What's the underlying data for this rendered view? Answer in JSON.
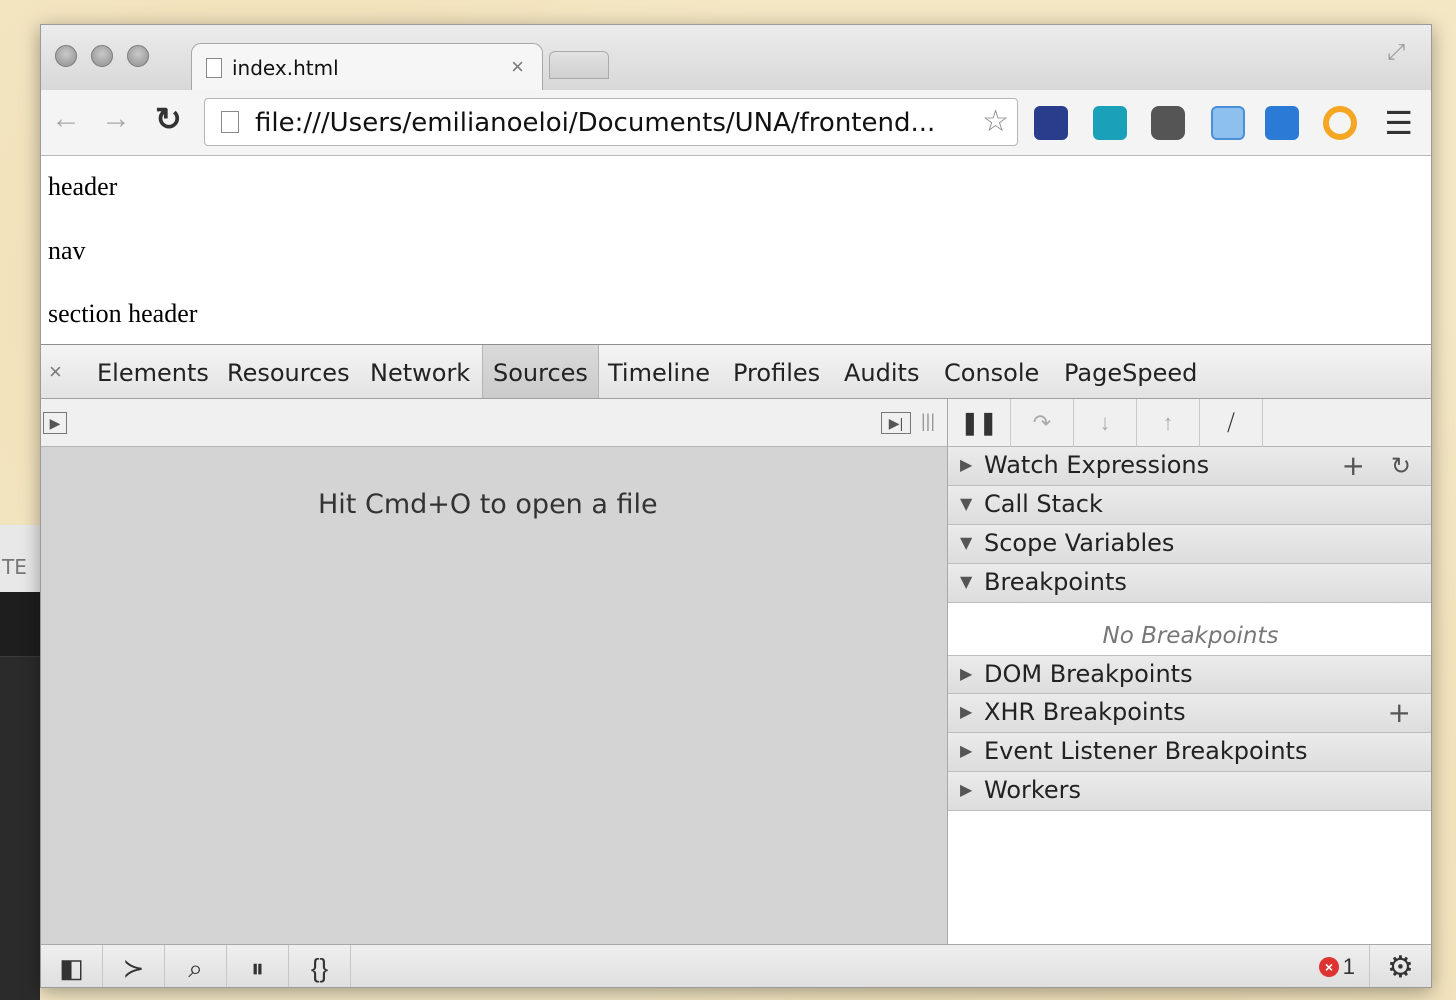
{
  "background": {
    "partial_label": "TE"
  },
  "browser": {
    "tab": {
      "title": "index.html",
      "close_label": "×"
    },
    "address_bar": {
      "url": "file:///Users/emilianoeloi/Documents/UNA/frontend..."
    },
    "icons": [
      "page-icon",
      "back-arrow-icon",
      "forward-arrow-icon",
      "reload-icon",
      "star-icon",
      "menu-icon"
    ],
    "extensions": [
      {
        "name": "speed-extension-icon",
        "color": "#2a3c8c"
      },
      {
        "name": "ink-extension-icon",
        "color": "#1aa0b8"
      },
      {
        "name": "pocket-extension-icon",
        "color": "#555555"
      },
      {
        "name": "window-extension-icon",
        "color": "#4a90d9"
      },
      {
        "name": "speaker-extension-icon",
        "color": "#2b7bd6"
      },
      {
        "name": "ring-extension-icon",
        "color": "#f5a623"
      }
    ]
  },
  "page": {
    "lines": [
      "header",
      "nav",
      "section header"
    ]
  },
  "devtools": {
    "close_label": "×",
    "tabs": [
      "Elements",
      "Resources",
      "Network",
      "Sources",
      "Timeline",
      "Profiles",
      "Audits",
      "Console",
      "PageSpeed"
    ],
    "active_tab": "Sources",
    "editor_hint": "Hit Cmd+O to open a file",
    "sidebar_panes": [
      {
        "label": "Watch Expressions",
        "expanded": false
      },
      {
        "label": "Call Stack",
        "expanded": true
      },
      {
        "label": "Scope Variables",
        "expanded": true
      },
      {
        "label": "Breakpoints",
        "expanded": true
      },
      {
        "label": "DOM Breakpoints",
        "expanded": false
      },
      {
        "label": "XHR Breakpoints",
        "expanded": false
      },
      {
        "label": "Event Listener Breakpoints",
        "expanded": false
      },
      {
        "label": "Workers",
        "expanded": false
      }
    ],
    "no_breakpoints": "No Breakpoints",
    "add_label": "+",
    "refresh_label": "C",
    "error_count": "1",
    "colors": {
      "error": "#dd3333",
      "active_tab_bg": "#cfcfcf"
    }
  }
}
